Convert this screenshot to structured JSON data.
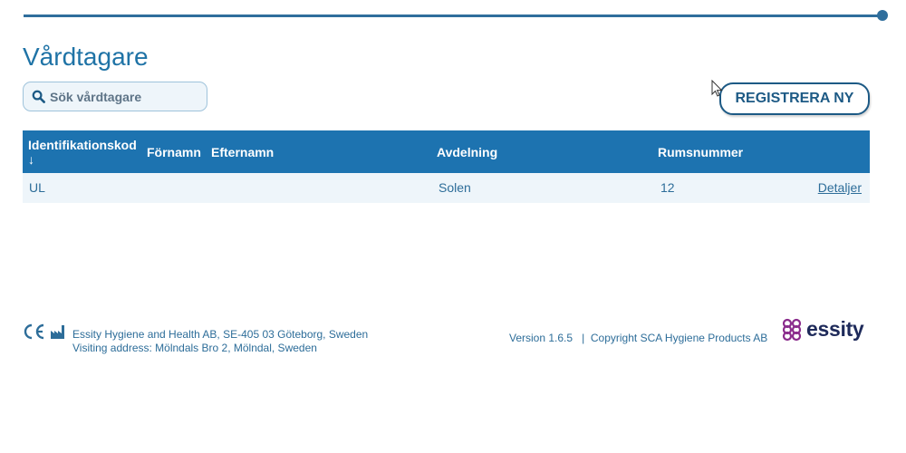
{
  "page": {
    "title": "Vårdtagare"
  },
  "search": {
    "placeholder": "Sök vårdtagare",
    "value": ""
  },
  "actions": {
    "register_label": "REGISTRERA NY"
  },
  "table": {
    "columns": {
      "id": "Identifikationskod",
      "sort_indicator": "↓",
      "first_name": "Förnamn",
      "last_name": "Efternamn",
      "department": "Avdelning",
      "room": "Rumsnummer"
    },
    "rows": [
      {
        "id": "UL",
        "first_name": "",
        "last_name": "",
        "department": "Solen",
        "room": "12",
        "details": "Detaljer"
      }
    ]
  },
  "footer": {
    "company": "Essity Hygiene and Health AB, SE-405 03 Göteborg, Sweden",
    "address": "Visiting address: Mölndals Bro 2, Mölndal, Sweden",
    "version": "Version 1.6.5",
    "separator": "|",
    "copyright": "Copyright SCA Hygiene Products AB",
    "brand": "essity"
  },
  "icons": {
    "search": "search-icon",
    "ce_mark": "ce-mark-icon",
    "manufacturer": "manufacturer-icon",
    "brand_logo": "essity-logo-icon",
    "cursor": "mouse-cursor-icon"
  },
  "colors": {
    "primary": "#1d73b0",
    "dark_blue": "#1d5a85",
    "text_blue": "#2d6d99",
    "row_bg": "#eef5fa",
    "logo_purple": "#8a2b8c"
  }
}
